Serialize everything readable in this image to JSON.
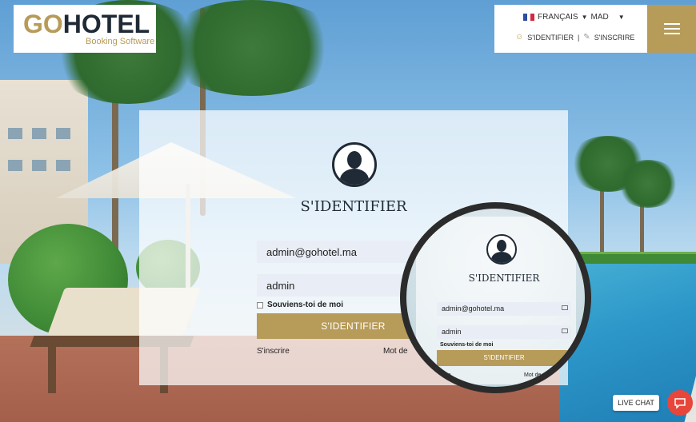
{
  "brand": {
    "logo_text_a": "GO",
    "logo_text_b": "HOTEL",
    "logo_sub": "Booking Software"
  },
  "topbar": {
    "language": "FRANÇAIS",
    "currency": "MAD",
    "signin": "S'IDENTIFIER",
    "separator": "|",
    "signup": "S'INSCRIRE"
  },
  "login": {
    "title": "S'IDENTIFIER",
    "email_value": "admin@gohotel.ma",
    "password_value": "admin",
    "remember_label": "Souviens-toi de moi",
    "submit_label": "S'IDENTIFIER",
    "register_link": "S'inscrire",
    "forgot_link": "Mot de"
  },
  "magnifier": {
    "title": "S'IDENTIFIER",
    "email_value": "admin@gohotel.ma",
    "password_value": "admin",
    "remember_label": "Souviens-toi de moi",
    "submit_label": "S'IDENTIFIER",
    "register_link": "crire",
    "forgot_link": "Mot de passe"
  },
  "chat": {
    "label": "LIVE CHAT"
  },
  "colors": {
    "accent": "#b79b59",
    "navy": "#1f2a36",
    "chat_red": "#e8463b"
  }
}
